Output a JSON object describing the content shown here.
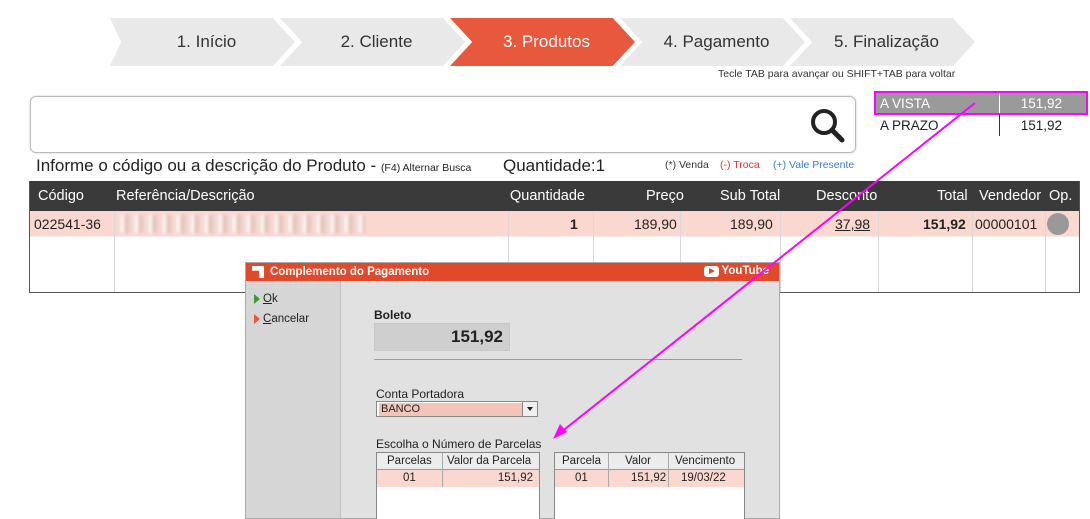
{
  "steps": [
    "1. Início",
    "2. Cliente",
    "3. Produtos",
    "4. Pagamento",
    "5. Finalização"
  ],
  "active_step": 2,
  "hint": "Tecle TAB para avançar ou SHIFT+TAB para voltar",
  "search": {
    "value": ""
  },
  "payment_summary": [
    {
      "label": "A VISTA",
      "value": "151,92",
      "selected": true
    },
    {
      "label": "A PRAZO",
      "value": "151,92",
      "selected": false
    }
  ],
  "info": {
    "main": "Informe o código ou a descrição do Produto -",
    "shortcut": "(F4) Alternar Busca",
    "qty_label": "Quantidade:",
    "qty_value": "1",
    "legend_sale": "(*) Venda",
    "legend_swap": "(-) Troca",
    "legend_gift": "(+) Vale Presente"
  },
  "table": {
    "headers": {
      "code": "Código",
      "desc": "Referência/Descrição",
      "qty": "Quantidade",
      "price": "Preço",
      "subtotal": "Sub Total",
      "discount": "Desconto",
      "total": "Total",
      "seller": "Vendedor",
      "op": "Op."
    },
    "rows": [
      {
        "code": "022541-36",
        "qty": "1",
        "price": "189,90",
        "subtotal": "189,90",
        "discount": "37,98",
        "total": "151,92",
        "seller": "00000101"
      }
    ]
  },
  "dialog": {
    "title": "Complemento do Pagamento",
    "youtube": "YouTube",
    "menu": {
      "ok_u": "O",
      "ok_rest": "k",
      "cancel_u": "C",
      "cancel_rest": "ancelar"
    },
    "boleto_label": "Boleto",
    "boleto_value": "151,92",
    "conta_label": "Conta Portadora",
    "conta_value": "BANCO",
    "parcelas_label": "Escolha o Número de Parcelas",
    "left_table": {
      "headers": [
        "Parcelas",
        "Valor da Parcela"
      ],
      "rows": [
        [
          "01",
          "151,92"
        ]
      ]
    },
    "right_table": {
      "headers": [
        "Parcela",
        "Valor",
        "Vencimento"
      ],
      "rows": [
        [
          "01",
          "151,92",
          "19/03/22"
        ]
      ]
    }
  },
  "colors": {
    "accent": "#e8583c",
    "annotation": "#ff00ff",
    "row_highlight": "#fbd8cf"
  }
}
